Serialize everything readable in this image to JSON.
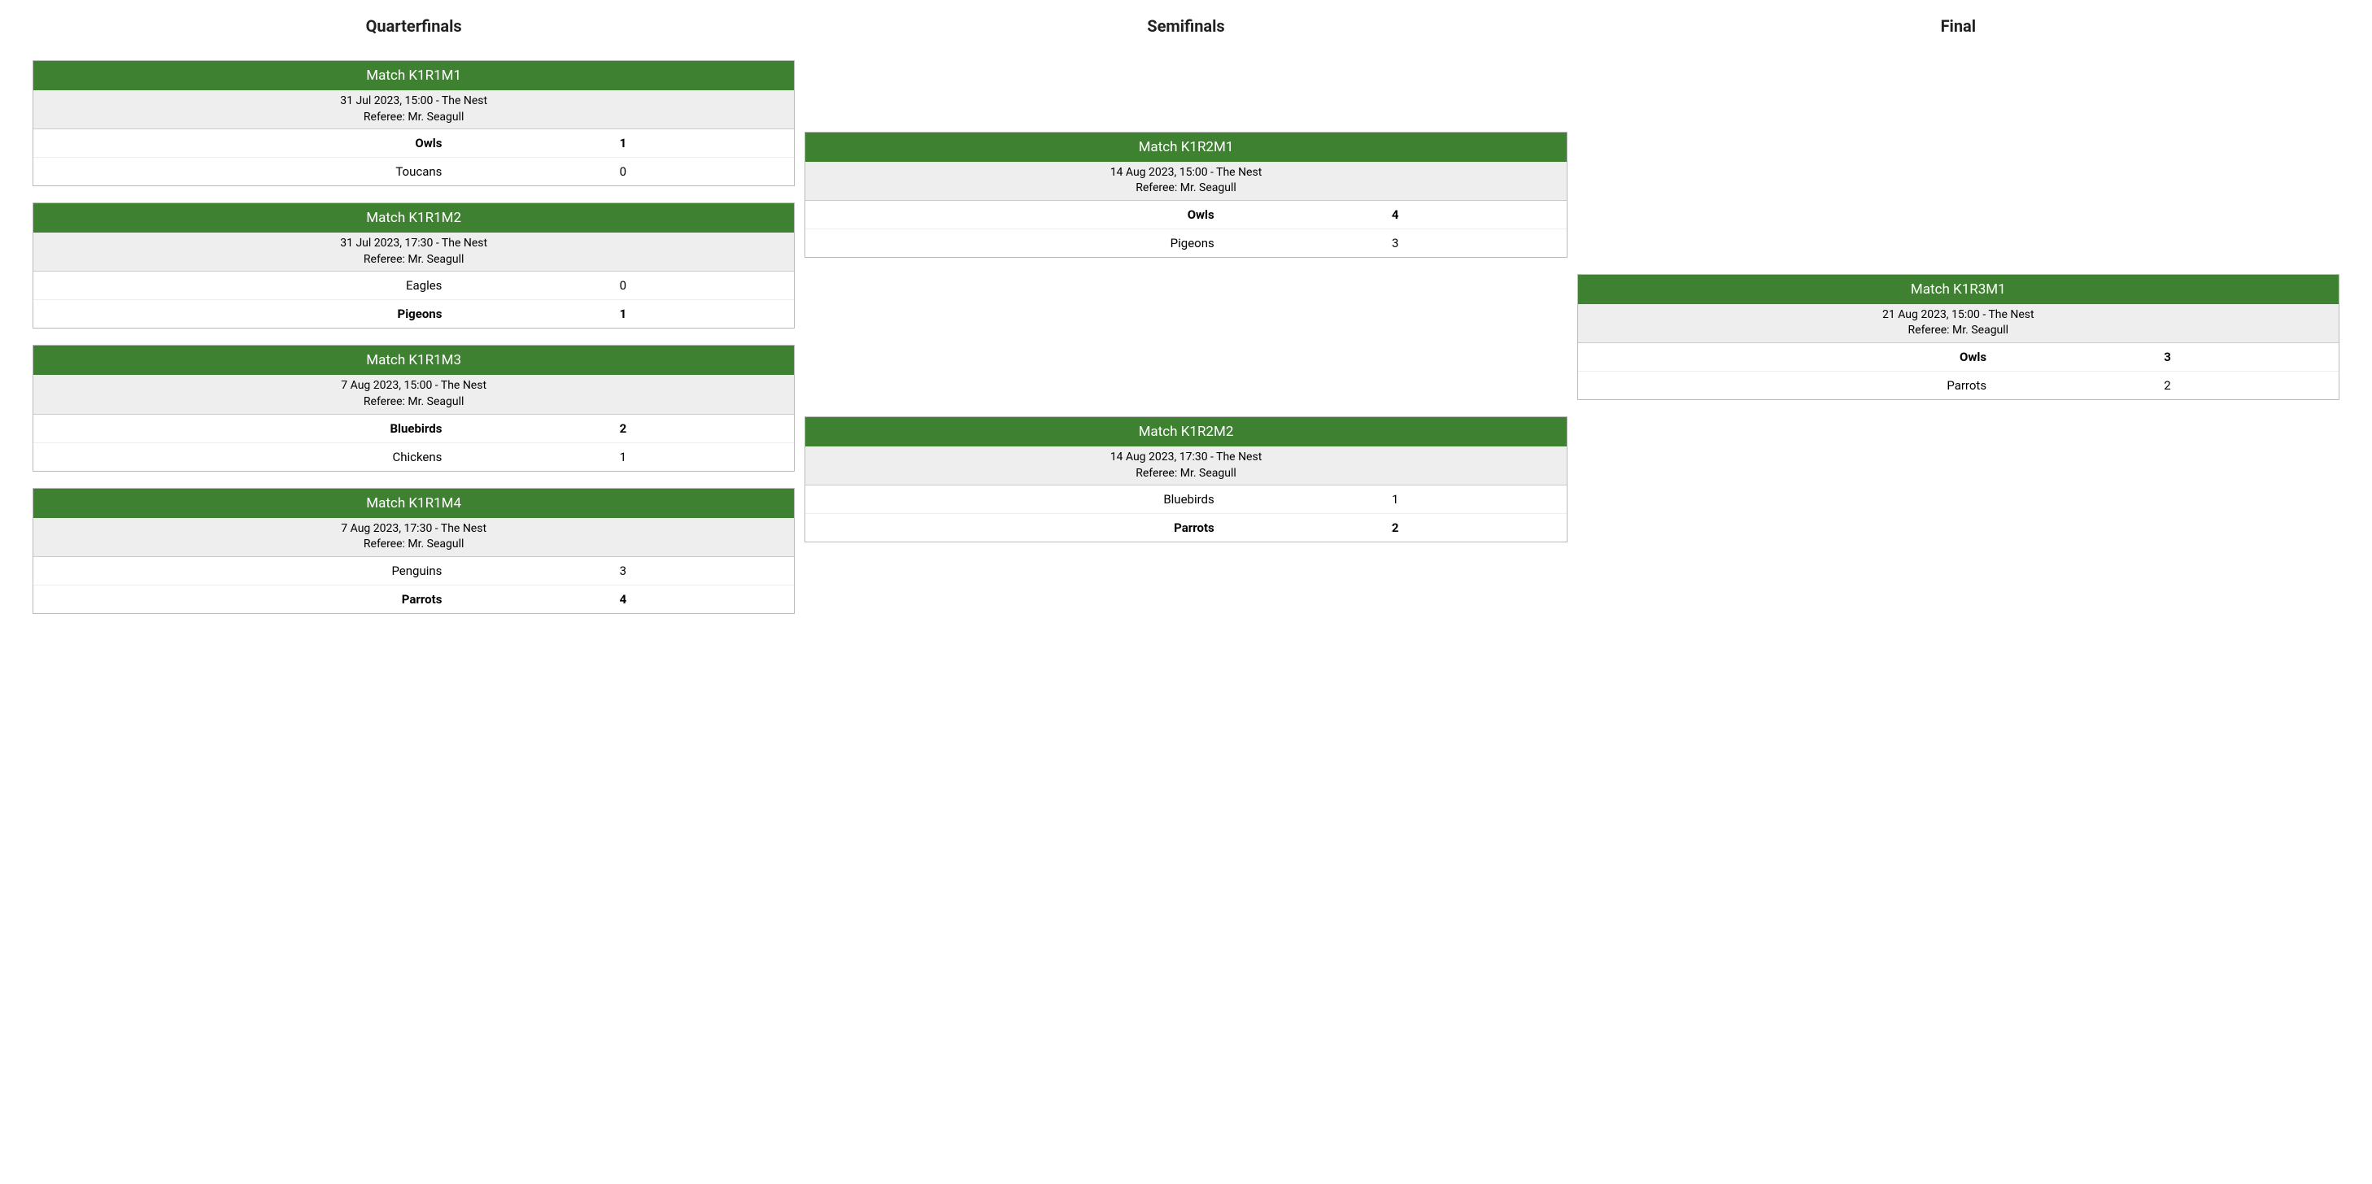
{
  "rounds": [
    {
      "title": "Quarterfinals",
      "matches": [
        {
          "header": "Match K1R1M1",
          "datetime_venue": "31 Jul 2023, 15:00 - The Nest",
          "referee": "Referee: Mr. Seagull",
          "teams": [
            {
              "name": "Owls",
              "score": "1",
              "winner": true
            },
            {
              "name": "Toucans",
              "score": "0",
              "winner": false
            }
          ]
        },
        {
          "header": "Match K1R1M2",
          "datetime_venue": "31 Jul 2023, 17:30 - The Nest",
          "referee": "Referee: Mr. Seagull",
          "teams": [
            {
              "name": "Eagles",
              "score": "0",
              "winner": false
            },
            {
              "name": "Pigeons",
              "score": "1",
              "winner": true
            }
          ]
        },
        {
          "header": "Match K1R1M3",
          "datetime_venue": "7 Aug 2023, 15:00 - The Nest",
          "referee": "Referee: Mr. Seagull",
          "teams": [
            {
              "name": "Bluebirds",
              "score": "2",
              "winner": true
            },
            {
              "name": "Chickens",
              "score": "1",
              "winner": false
            }
          ]
        },
        {
          "header": "Match K1R1M4",
          "datetime_venue": "7 Aug 2023, 17:30 - The Nest",
          "referee": "Referee: Mr. Seagull",
          "teams": [
            {
              "name": "Penguins",
              "score": "3",
              "winner": false
            },
            {
              "name": "Parrots",
              "score": "4",
              "winner": true
            }
          ]
        }
      ]
    },
    {
      "title": "Semifinals",
      "matches": [
        {
          "header": "Match K1R2M1",
          "datetime_venue": "14 Aug 2023, 15:00 - The Nest",
          "referee": "Referee: Mr. Seagull",
          "teams": [
            {
              "name": "Owls",
              "score": "4",
              "winner": true
            },
            {
              "name": "Pigeons",
              "score": "3",
              "winner": false
            }
          ]
        },
        {
          "header": "Match K1R2M2",
          "datetime_venue": "14 Aug 2023, 17:30 - The Nest",
          "referee": "Referee: Mr. Seagull",
          "teams": [
            {
              "name": "Bluebirds",
              "score": "1",
              "winner": false
            },
            {
              "name": "Parrots",
              "score": "2",
              "winner": true
            }
          ]
        }
      ]
    },
    {
      "title": "Final",
      "matches": [
        {
          "header": "Match K1R3M1",
          "datetime_venue": "21 Aug 2023, 15:00 - The Nest",
          "referee": "Referee: Mr. Seagull",
          "teams": [
            {
              "name": "Owls",
              "score": "3",
              "winner": true
            },
            {
              "name": "Parrots",
              "score": "2",
              "winner": false
            }
          ]
        }
      ]
    }
  ]
}
